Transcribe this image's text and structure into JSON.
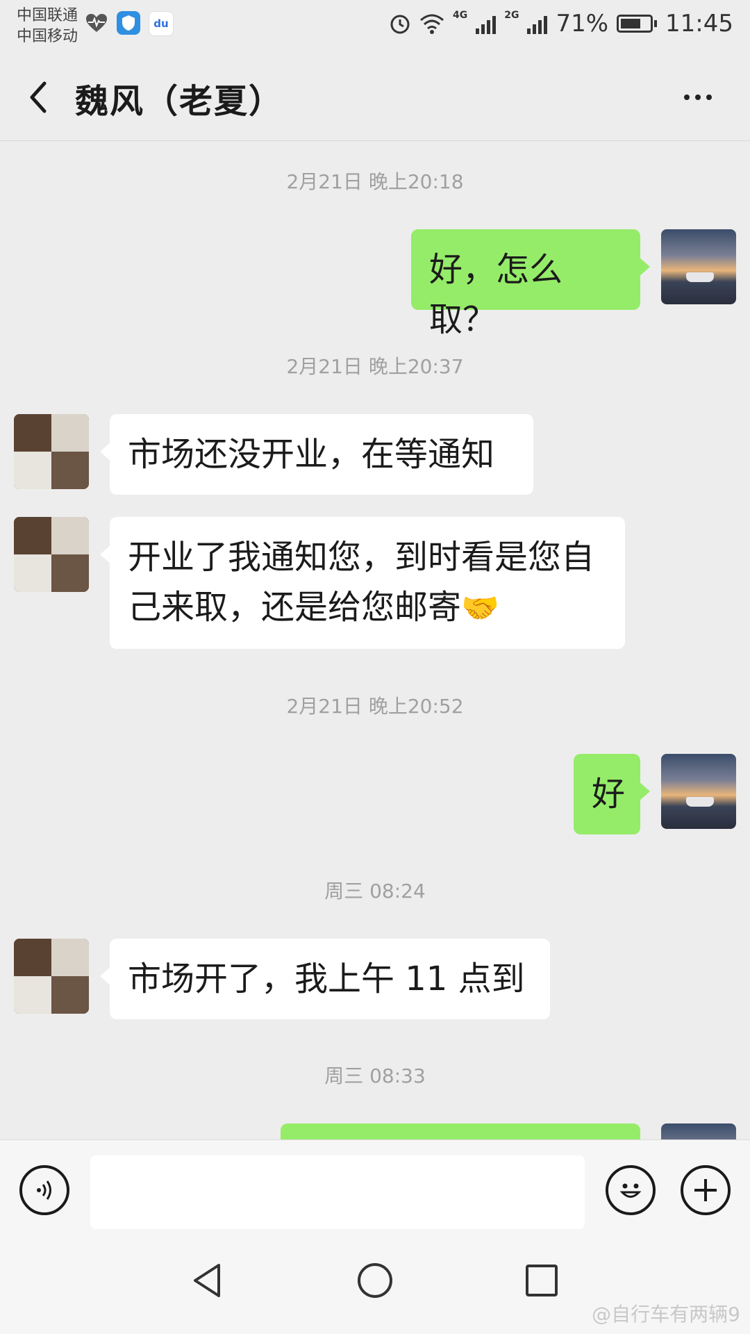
{
  "status_bar": {
    "carrier_1": "中国联通",
    "carrier_2": "中国移动",
    "network_1": "4G",
    "network_2": "2G",
    "battery_percent": "71%",
    "battery_level": 0.71,
    "time": "11:45",
    "left_icons": [
      "heartbeat-icon",
      "shield-app-icon",
      "baidu-app-icon"
    ],
    "right_icons": [
      "alarm-icon",
      "wifi-icon",
      "signal-icon",
      "signal-icon",
      "battery-icon"
    ]
  },
  "header": {
    "title": "魏风（老夏）",
    "back_icon": "chevron-left-icon",
    "more_icon": "more-dots-icon"
  },
  "chat": {
    "items": [
      {
        "type": "timestamp",
        "text": "2月21日 晚上20:18"
      },
      {
        "type": "message",
        "side": "self",
        "text": "好，怎么取？"
      },
      {
        "type": "timestamp",
        "text": "2月21日 晚上20:37"
      },
      {
        "type": "message",
        "side": "other",
        "text": "市场还没开业，在等通知"
      },
      {
        "type": "message",
        "side": "other",
        "text": "开业了我通知您，到时看是您自己来取，还是给您邮寄",
        "emoji": "🤝"
      },
      {
        "type": "timestamp",
        "text": "2月21日 晚上20:52"
      },
      {
        "type": "message",
        "side": "self",
        "text": "好"
      },
      {
        "type": "timestamp",
        "text": "周三 08:24"
      },
      {
        "type": "message",
        "side": "other",
        "text": "市场开了，我上午 11 点到"
      },
      {
        "type": "timestamp",
        "text": "周三 08:33"
      }
    ]
  },
  "input_bar": {
    "voice_icon": "voice-icon",
    "placeholder": "",
    "emoji_icon": "emoji-icon",
    "plus_icon": "plus-icon"
  },
  "nav_bar": {
    "back_icon": "nav-back-icon",
    "home_icon": "nav-home-icon",
    "recent_icon": "nav-recent-icon"
  },
  "watermark": "@自行车有两辆9",
  "colors": {
    "self_bubble": "#95ec69",
    "other_bubble": "#ffffff",
    "chat_background": "#ededed",
    "timestamp_text": "#a0a0a0"
  }
}
